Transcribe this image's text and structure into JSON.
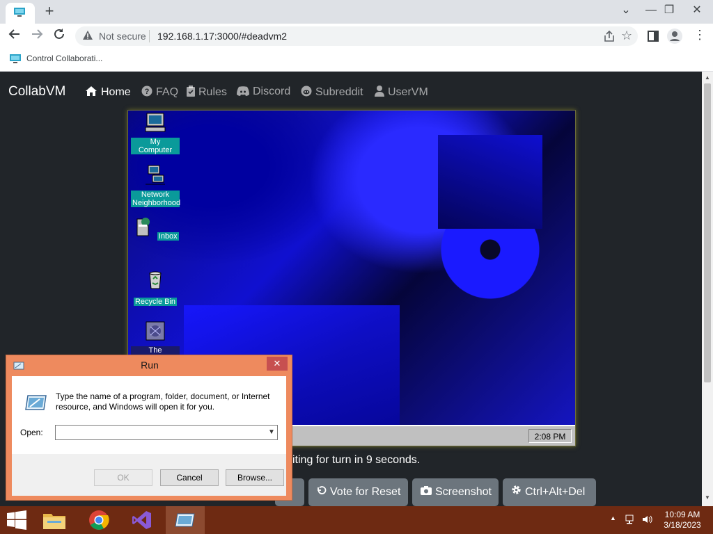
{
  "browser": {
    "tab_label": "",
    "newtab": "+",
    "window_controls": [
      "⌄",
      "—",
      "❐",
      "✕"
    ],
    "not_secure": "Not secure",
    "url": "192.168.1.17:3000/#deadvm2",
    "bookmark": "Control Collaborati..."
  },
  "site": {
    "brand": "CollabVM",
    "nav": [
      {
        "label": "Home",
        "icon": "home-icon"
      },
      {
        "label": "FAQ",
        "icon": "question-circle-icon"
      },
      {
        "label": "Rules",
        "icon": "clipboard-check-icon"
      },
      {
        "label": "Discord",
        "icon": "discord-icon"
      },
      {
        "label": "Subreddit",
        "icon": "reddit-icon"
      },
      {
        "label": "UserVM",
        "icon": "user-icon"
      }
    ],
    "turn_status": "iting for turn in 9 seconds.",
    "buttons": {
      "partial": "e",
      "vote_reset": "Vote for Reset",
      "screenshot": "Screenshot",
      "ctrl_alt_del": "Ctrl+Alt+Del"
    }
  },
  "vm": {
    "desktop_icons": [
      {
        "label": "My Computer",
        "icon": "my-computer-icon"
      },
      {
        "label": "Network Neighborhood",
        "icon": "network-neighborhood-icon"
      },
      {
        "label": "Inbox",
        "icon": "inbox-icon"
      },
      {
        "label": "Recycle Bin",
        "icon": "recycle-bin-icon"
      },
      {
        "label": "The Microsoft",
        "icon": "msn-icon"
      }
    ],
    "clock": "2:08 PM"
  },
  "run_dialog": {
    "title": "Run",
    "close": "✕",
    "description": "Type the name of a program, folder, document, or Internet resource, and Windows will open it for you.",
    "open_label": "Open:",
    "open_value": "",
    "ok": "OK",
    "cancel": "Cancel",
    "browse": "Browse..."
  },
  "taskbar": {
    "time": "10:09 AM",
    "date": "3/18/2023",
    "apps": [
      "file-explorer-icon",
      "chrome-icon",
      "visual-studio-icon",
      "run-icon"
    ]
  }
}
